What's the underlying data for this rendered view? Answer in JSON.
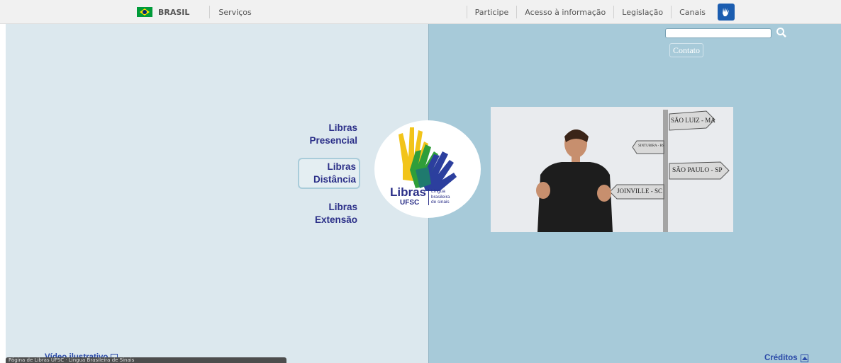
{
  "govbar": {
    "brasil_label": "BRASIL",
    "servicos_label": "Serviços",
    "menu": [
      "Participe",
      "Acesso à informação",
      "Legislação",
      "Canais"
    ],
    "accessibility_icon": "hand-sign-icon"
  },
  "nav": {
    "presencial": [
      "Libras",
      "Presencial"
    ],
    "distancia": [
      "Libras",
      "Distância"
    ],
    "extensao": [
      "Libras",
      "Extensão"
    ]
  },
  "logo": {
    "brand": "Libras",
    "sub": "UFSC",
    "tagline": [
      "Língua",
      "brasileira",
      "de sinais"
    ]
  },
  "search": {
    "placeholder": "",
    "icon": "search-icon"
  },
  "contato_label": "Contato",
  "video": {
    "signs": [
      "SÃO LUIZ - MA",
      "SINTUBIRA - RS",
      "SÃO PAULO - SP",
      "JOINVILLE - SC"
    ]
  },
  "footer": {
    "creditos_label": "Créditos",
    "video_link_label": "Vídeo ilustrativo",
    "status_text": "Página de Libras UFSC · Língua Brasileira de Sinais"
  },
  "colors": {
    "left_panel": "#dce8ee",
    "right_panel": "#a7cad9",
    "nav_text": "#2b2f88",
    "link_blue": "#2b4aa8"
  }
}
